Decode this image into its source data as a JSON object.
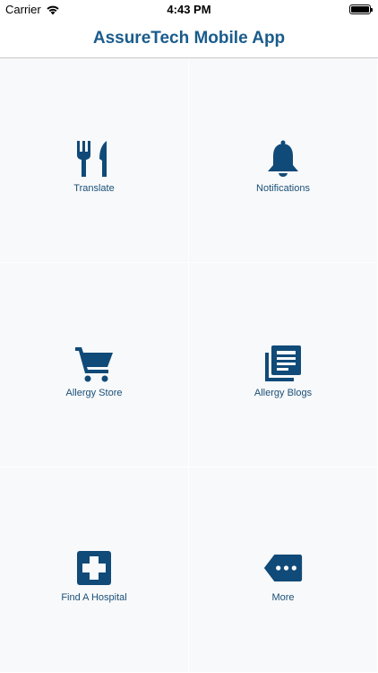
{
  "status_bar": {
    "carrier": "Carrier",
    "time": "4:43 PM",
    "wifi_icon": "wifi-icon",
    "battery_icon": "battery-icon"
  },
  "nav": {
    "title": "AssureTech Mobile App"
  },
  "colors": {
    "accent": "#1a5c8c",
    "icon": "#104a78",
    "tile_bg": "#f8f9fa"
  },
  "tiles": [
    {
      "label": "Translate",
      "icon": "fork-knife-icon"
    },
    {
      "label": "Notifications",
      "icon": "bell-icon"
    },
    {
      "label": "Allergy Store",
      "icon": "shopping-cart-icon"
    },
    {
      "label": "Allergy Blogs",
      "icon": "newspaper-icon"
    },
    {
      "label": "Find A Hospital",
      "icon": "medical-cross-icon"
    },
    {
      "label": "More",
      "icon": "more-tag-icon"
    }
  ]
}
